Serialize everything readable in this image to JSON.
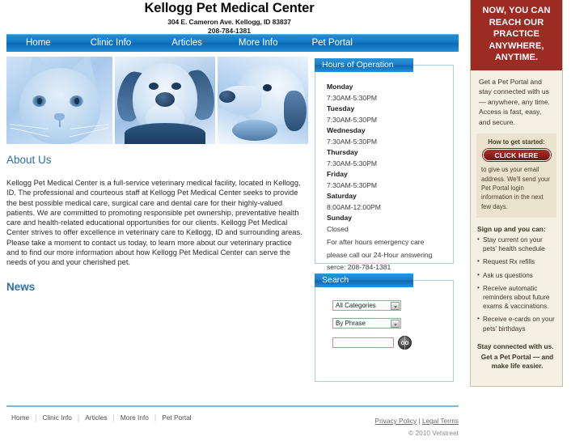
{
  "header": {
    "title": "Kellogg Pet Medical Center",
    "address": "304 E. Cameron Ave. Kellogg, ID 83837",
    "phone": "208-784-1381"
  },
  "nav": {
    "items": [
      {
        "label": "Home"
      },
      {
        "label": "Clinic Info"
      },
      {
        "label": "Articles"
      },
      {
        "label": "More Info"
      },
      {
        "label": "Pet Portal"
      }
    ]
  },
  "main": {
    "about_heading": "About Us",
    "about_body": "Kellogg Pet Medical Center is a full-service veterinary medical facility, located in Kellogg, ID. The professional and courteous staff at Kellogg Pet Medical Center seeks to provide the best possible medical care, surgical care and dental care for their highly-valued patients. We are committed to promoting responsible pet ownership, preventative health care and health-related educational opportunities for our clients. Kellogg Pet Medical Center strives to offer excellence in veterinary care to Kellogg, ID and surrounding areas. Please take a moment to contact us today, to learn more about our veterinary practice and to find our more information about how Kellogg Pet Medical Center can serve the needs of you and your cherished pet.",
    "news_heading": "News"
  },
  "hours": {
    "title": "Hours of Operation",
    "rows": [
      {
        "day": "Monday",
        "time": "7:30AM-5:30PM"
      },
      {
        "day": "Tuesday",
        "time": "7:30AM-5:30PM"
      },
      {
        "day": "Wednesday",
        "time": "7:30AM-5:30PM"
      },
      {
        "day": "Thursday",
        "time": "7:30AM-5:30PM"
      },
      {
        "day": "Friday",
        "time": "7:30AM-5:30PM"
      },
      {
        "day": "Saturday",
        "time": "8:00AM-12:00PM"
      },
      {
        "day": "Sunday",
        "time": "Closed"
      }
    ],
    "note_line1": "For after hours emergency care",
    "note_line2": "please call our 24-Hour answering",
    "note_line3": "serce: 208-784-1381"
  },
  "search": {
    "title": "Search",
    "category_value": "All Categories",
    "mode_value": "By Phrase",
    "input_value": "",
    "input_placeholder": "",
    "go_label": "GO"
  },
  "sidebar": {
    "promo_lines": [
      "NOW, YOU CAN",
      "REACH OUR",
      "PRACTICE",
      "ANYWHERE,",
      "ANYTIME."
    ],
    "intro": "Get a Pet Portal and stay connected with us — anywhere, any time. Access is fast, easy, and secure.",
    "box_title": "How to get started:",
    "click_here_label": "CLICK HERE",
    "box_note": "to give us your email address. We'll send your Pet Portal login information in the next few days.",
    "signup_title": "Sign up and you can:",
    "benefits": [
      "Stay current  on your pets' health schedule",
      "Request Rx refills",
      "Ask us questions",
      "Receive automatic reminders about future exams & vaccinations.",
      "Receive e-cards on your pets' birthdays"
    ],
    "footer_line1": "Stay connected with us.",
    "footer_line2": "Get a Pet Portal — and make life easier."
  },
  "footer": {
    "links": [
      {
        "label": "Home"
      },
      {
        "label": "Clinic Info"
      },
      {
        "label": "Articles"
      },
      {
        "label": "More Info"
      },
      {
        "label": "Pet Portal"
      }
    ],
    "separator": "|",
    "privacy_policy": "Privacy Policy",
    "legal_terms": "Legal Terms",
    "copyright": "© 2010 Vetstreet"
  },
  "colors": {
    "nav_blue": "#1479c4",
    "heading_blue": "#2f6fab",
    "promo_red": "#9c2b24",
    "sidebar_cream": "#f5f0e4",
    "panel_border": "#a9cfe8"
  }
}
